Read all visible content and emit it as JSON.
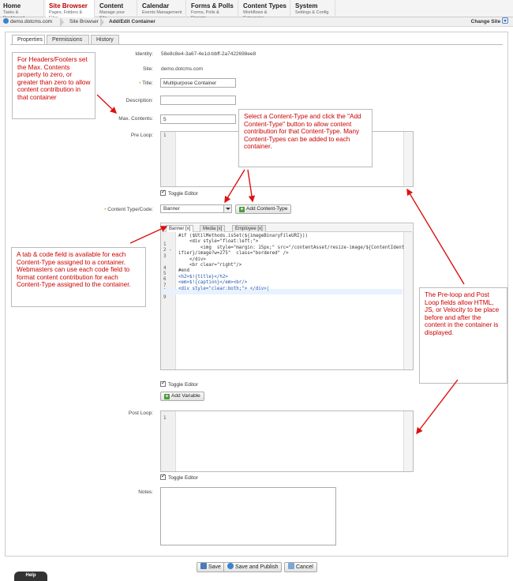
{
  "nav": [
    {
      "title": "Home",
      "sub": "Tasks & Dashboard"
    },
    {
      "title": "Site Browser",
      "sub": "Pages, Folders & Files"
    },
    {
      "title": "Content",
      "sub": "Manage your Site"
    },
    {
      "title": "Calendar",
      "sub": "Events Management"
    },
    {
      "title": "Forms & Polls",
      "sub": "Forms, Polls & Reports"
    },
    {
      "title": "Content Types",
      "sub": "Workflows & Categories"
    },
    {
      "title": "System",
      "sub": "Settings & Config"
    }
  ],
  "breadcrumb": {
    "site": "demo.dotcms.com",
    "browser": "Site Browser",
    "page": "Add/Edit Container"
  },
  "change_site": "Change Site",
  "tabs": [
    "Properties",
    "Permissions",
    "History"
  ],
  "form": {
    "identity_label": "Identity:",
    "identity_value": "58e8c8e4-3a67-4e1d-bbff-2a7422698ee8",
    "site_label": "Site:",
    "site_value": "demo.dotcms.com",
    "req_mark": "•",
    "title_label": "Title:",
    "title_value": "Multipurpose Container",
    "description_label": "Description:",
    "description_value": "",
    "max_label": "Max. Contents:",
    "max_value": "5",
    "preloop_label": "Pre Loop:",
    "ctype_label": "Content Type/Code:",
    "ctype_value": "Banner",
    "add_ctype": "Add Content-Type",
    "postloop_label": "Post Loop:",
    "notes_label": "Notes:",
    "toggle_editor": "Toggle Editor",
    "add_variable": "Add Variable"
  },
  "code_tabs": [
    "Banner [x]",
    "Media [x]",
    "Employee [x]"
  ],
  "code_lines": [
    {
      "n": "1",
      "t": "#if ($UtilMethods.isSet(${imageBinaryFileURI}))"
    },
    {
      "n": "2 -",
      "t": "    <div style=\"float:left;\">"
    },
    {
      "n": "3",
      "t": "        <img  style=\"margin: 15px;\" src=\"/contentAsset/resize-image/${ContentIdent"
    },
    {
      "n": "",
      "t": "ifier}/image?w=275\"  class=\"bordered\" />"
    },
    {
      "n": "4",
      "t": "    </div>"
    },
    {
      "n": "5",
      "t": "    <br clear=\"right\"/>"
    },
    {
      "n": "6",
      "t": "#end"
    },
    {
      "n": "7",
      "t": "<h2>$!{title}</h2>"
    },
    {
      "n": "8",
      "t": "<em>$!{caption}</em><br/>"
    },
    {
      "n": "9",
      "t": "<div style=\"clear:both;\"> </div>|"
    }
  ],
  "preloop_line": "1",
  "postloop_line": "1",
  "notes": [
    "For Headers/Footers set the Max. Contents property to zero, or greater than zero to allow content contribution in that container",
    "Select a Content-Type and click the \"Add Content-Type\" button to allow content contribution for that Content-Type.  Many Content-Types can be added to each container.",
    "A tab & code field is available for each Content-Type assigned to a container.  Webmasters can use each code field to format content contribution for each Content-Type assigned to the container.",
    "The Pre-loop and Post Loop fields allow HTML, JS, or Velocity to be place before and after the content in the container is displayed."
  ],
  "buttons": {
    "save": "Save",
    "save_publish": "Save and Publish",
    "cancel": "Cancel"
  },
  "help": "Help",
  "colors": {
    "accent": "#b00000",
    "note_text": "#cc0000",
    "add_green": "#4a9a3a"
  }
}
